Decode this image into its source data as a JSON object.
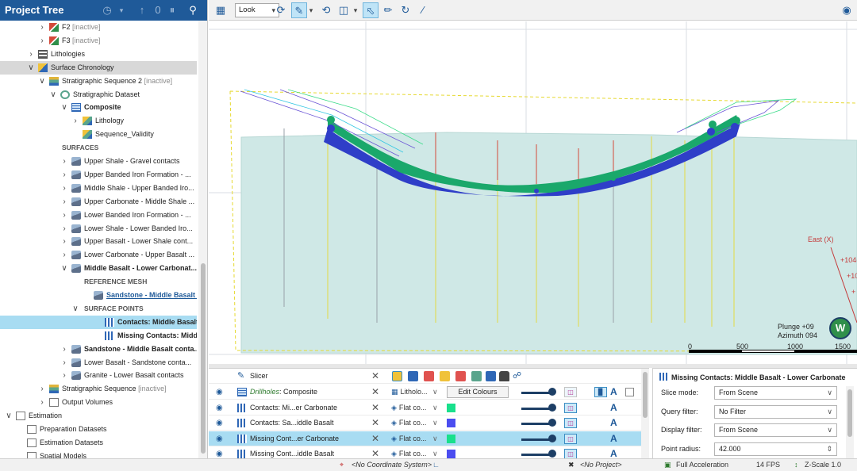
{
  "project_tree": {
    "title": "Project Tree",
    "rows": [
      {
        "label": "F2",
        "suffix": "[inactive]",
        "indent": 4,
        "chev": ">",
        "icon": "fault-icon",
        "style": ""
      },
      {
        "label": "F3",
        "suffix": "[inactive]",
        "indent": 4,
        "chev": ">",
        "icon": "fault-icon",
        "style": ""
      },
      {
        "label": "Lithologies",
        "suffix": "",
        "indent": 3,
        "chev": ">",
        "icon": "list-icon",
        "style": ""
      },
      {
        "label": "Surface Chronology",
        "suffix": "",
        "indent": 3,
        "chev": "v",
        "icon": "chronology-icon",
        "style": "",
        "sel": "grey"
      },
      {
        "label": "Stratigraphic Sequence 2",
        "suffix": "[inactive]",
        "indent": 4,
        "chev": "v",
        "icon": "sequence-icon",
        "style": ""
      },
      {
        "label": "Stratigraphic Dataset",
        "suffix": "",
        "indent": 5,
        "chev": "v",
        "icon": "dataset-icon",
        "style": ""
      },
      {
        "label": "Composite",
        "suffix": "",
        "indent": 6,
        "chev": "v",
        "icon": "grid-icon",
        "style": "bold"
      },
      {
        "label": "Lithology",
        "suffix": "",
        "indent": 7,
        "chev": ">",
        "icon": "lithology-icon",
        "style": ""
      },
      {
        "label": "Sequence_Validity",
        "suffix": "",
        "indent": 7,
        "chev": "",
        "icon": "lithology-icon",
        "style": ""
      },
      {
        "label": "SURFACES",
        "suffix": "",
        "indent": 5,
        "chev": "",
        "icon": "",
        "style": "section"
      },
      {
        "label": "Upper Shale - Gravel contacts",
        "suffix": "",
        "indent": 6,
        "chev": ">",
        "icon": "surface-icon",
        "style": ""
      },
      {
        "label": "Upper Banded Iron Formation - ...",
        "suffix": "",
        "indent": 6,
        "chev": ">",
        "icon": "surface-icon",
        "style": ""
      },
      {
        "label": "Middle Shale - Upper Banded Iro...",
        "suffix": "",
        "indent": 6,
        "chev": ">",
        "icon": "surface-icon",
        "style": ""
      },
      {
        "label": "Upper Carbonate - Middle Shale ...",
        "suffix": "",
        "indent": 6,
        "chev": ">",
        "icon": "surface-icon",
        "style": ""
      },
      {
        "label": "Lower Banded Iron Formation - ...",
        "suffix": "",
        "indent": 6,
        "chev": ">",
        "icon": "surface-icon",
        "style": ""
      },
      {
        "label": "Lower Shale - Lower Banded Iro...",
        "suffix": "",
        "indent": 6,
        "chev": ">",
        "icon": "surface-icon",
        "style": ""
      },
      {
        "label": "Upper Basalt - Lower Shale cont...",
        "suffix": "",
        "indent": 6,
        "chev": ">",
        "icon": "surface-icon",
        "style": ""
      },
      {
        "label": "Lower Carbonate - Upper Basalt ...",
        "suffix": "",
        "indent": 6,
        "chev": ">",
        "icon": "surface-icon",
        "style": ""
      },
      {
        "label": "Middle Basalt - Lower Carbonat...",
        "suffix": "",
        "indent": 6,
        "chev": "v",
        "icon": "surface-icon",
        "style": "bold"
      },
      {
        "label": "REFERENCE MESH",
        "suffix": "",
        "indent": 7,
        "chev": "",
        "icon": "",
        "style": "section"
      },
      {
        "label": "Sandstone - Middle Basalt c...",
        "suffix": "",
        "indent": 8,
        "chev": "",
        "icon": "surface-icon",
        "style": "link"
      },
      {
        "label": "SURFACE POINTS",
        "suffix": "",
        "indent": 7,
        "chev": "v",
        "icon": "",
        "style": "section"
      },
      {
        "label": "Contacts: Middle Basalt ...",
        "suffix": "",
        "indent": 9,
        "chev": "",
        "icon": "points-icon",
        "style": "bold",
        "sel": "blue"
      },
      {
        "label": "Missing Contacts: Middl...",
        "suffix": "",
        "indent": 9,
        "chev": "",
        "icon": "points-icon",
        "style": "bold"
      },
      {
        "label": "Sandstone - Middle Basalt conta...",
        "suffix": "",
        "indent": 6,
        "chev": ">",
        "icon": "surface-icon",
        "style": "bold"
      },
      {
        "label": "Lower Basalt - Sandstone conta...",
        "suffix": "",
        "indent": 6,
        "chev": ">",
        "icon": "surface-icon",
        "style": ""
      },
      {
        "label": "Granite - Lower Basalt contacts",
        "suffix": "",
        "indent": 6,
        "chev": ">",
        "icon": "surface-icon",
        "style": ""
      },
      {
        "label": "Stratigraphic Sequence",
        "suffix": "[inactive]",
        "indent": 4,
        "chev": ">",
        "icon": "sequence-icon",
        "style": ""
      },
      {
        "label": "Output Volumes",
        "suffix": "",
        "indent": 4,
        "chev": ">",
        "icon": "folder-icon",
        "style": ""
      },
      {
        "label": "Estimation",
        "suffix": "",
        "indent": 1,
        "chev": "v",
        "icon": "folder-icon",
        "style": ""
      },
      {
        "label": "Preparation Datasets",
        "suffix": "",
        "indent": 2,
        "chev": "",
        "icon": "folder-icon",
        "style": ""
      },
      {
        "label": "Estimation Datasets",
        "suffix": "",
        "indent": 2,
        "chev": "",
        "icon": "folder-icon",
        "style": ""
      },
      {
        "label": "Spatial Models",
        "suffix": "",
        "indent": 2,
        "chev": "",
        "icon": "folder-icon",
        "style": ""
      }
    ]
  },
  "toolbar": {
    "look_value": "Look"
  },
  "viewport": {
    "plunge": "Plunge +09",
    "azimuth": "Azimuth 094",
    "compass_letter": "W",
    "scale_labels": [
      "0",
      "500",
      "1000",
      "1500"
    ],
    "east_label": "East (X)",
    "coord_labels": [
      "+104(",
      "+10",
      "+"
    ]
  },
  "shapes": {
    "slicer_label": "Slicer",
    "rows": [
      {
        "name": "Drillholes",
        "name_suffix": ": Composite",
        "mode": "Litholo...",
        "button": "Edit Colours",
        "swatch": "",
        "green_name": true
      },
      {
        "name": "Contacts: Mi...er Carbonate",
        "name_suffix": "",
        "mode": "Flat co...",
        "button": "",
        "swatch": "#19e08c",
        "green_name": false
      },
      {
        "name": "Contacts: Sa...iddle Basalt",
        "name_suffix": "",
        "mode": "Flat co...",
        "button": "",
        "swatch": "#4b4df0",
        "green_name": false
      },
      {
        "name": "Missing Cont...er Carbonate",
        "name_suffix": "",
        "mode": "Flat co...",
        "button": "",
        "swatch": "#19e08c",
        "green_name": false,
        "sel": true
      },
      {
        "name": "Missing Cont...iddle Basalt",
        "name_suffix": "",
        "mode": "Flat co...",
        "button": "",
        "swatch": "#4b4df0",
        "green_name": false
      }
    ]
  },
  "properties": {
    "title": "Missing Contacts: Middle Basalt - Lower Carbonate",
    "fields": [
      {
        "label": "Slice mode:",
        "value": "From Scene"
      },
      {
        "label": "Query filter:",
        "value": "No Filter"
      },
      {
        "label": "Display filter:",
        "value": "From Scene"
      },
      {
        "label": "Point radius:",
        "value": "42.000"
      }
    ]
  },
  "status": {
    "coordinate_system": "<No Coordinate System>",
    "project": "<No Project>",
    "acceleration": "Full Acceleration",
    "fps": "14 FPS",
    "zscale": "Z-Scale 1.0"
  },
  "colors": {
    "header": "#1f5a99",
    "green_surface": "#1aa86b",
    "blue_surface": "#2f3ec8",
    "teal_volume": "#cfe8e6"
  }
}
